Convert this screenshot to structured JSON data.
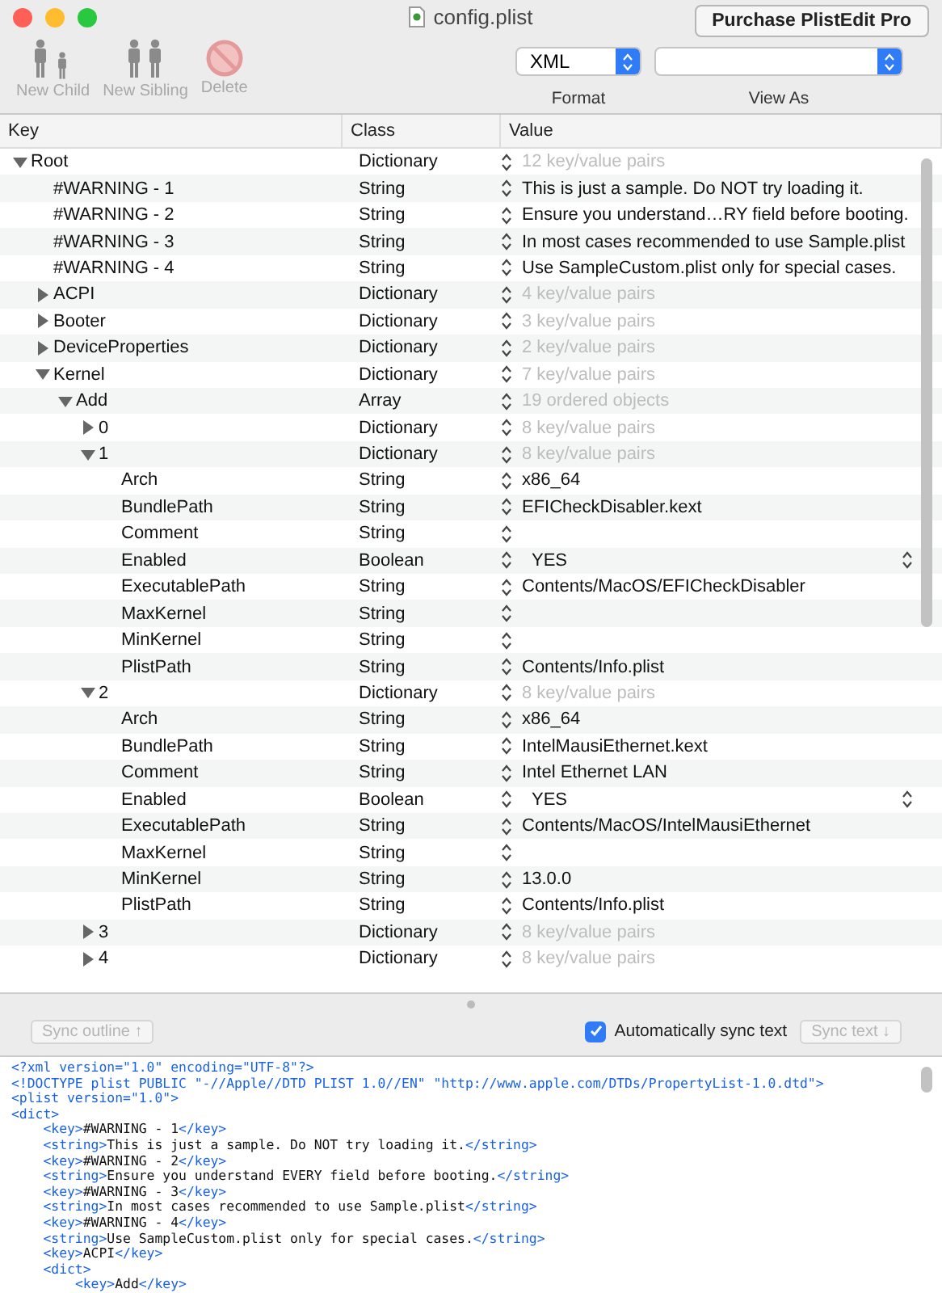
{
  "window": {
    "title": "config.plist"
  },
  "purchase_button": "Purchase PlistEdit Pro",
  "toolbar": [
    {
      "kind": "child",
      "label": "New Child",
      "disabled": true
    },
    {
      "kind": "sibling",
      "label": "New Sibling",
      "disabled": true
    },
    {
      "kind": "delete",
      "label": "Delete",
      "disabled": true
    }
  ],
  "format": {
    "value": "XML",
    "label": "Format"
  },
  "view_as": {
    "label": "View As"
  },
  "columns": [
    "Key",
    "Class",
    "Value"
  ],
  "tree": [
    {
      "key": "Root",
      "class": "Dictionary",
      "value": "12 key/value pairs",
      "kind": "summary",
      "expanded": true,
      "children": [
        {
          "key": "#WARNING - 1",
          "class": "String",
          "value": "This is just a sample. Do NOT try loading it.",
          "kind": "text"
        },
        {
          "key": "#WARNING - 2",
          "class": "String",
          "value": "Ensure you understand…RY field before booting.",
          "kind": "text"
        },
        {
          "key": "#WARNING - 3",
          "class": "String",
          "value": "In most cases recommended to use Sample.plist",
          "kind": "text"
        },
        {
          "key": "#WARNING - 4",
          "class": "String",
          "value": "Use SampleCustom.plist only for special cases.",
          "kind": "text"
        },
        {
          "key": "ACPI",
          "class": "Dictionary",
          "value": "4 key/value pairs",
          "kind": "summary",
          "expanded": false
        },
        {
          "key": "Booter",
          "class": "Dictionary",
          "value": "3 key/value pairs",
          "kind": "summary",
          "expanded": false
        },
        {
          "key": "DeviceProperties",
          "class": "Dictionary",
          "value": "2 key/value pairs",
          "kind": "summary",
          "expanded": false
        },
        {
          "key": "Kernel",
          "class": "Dictionary",
          "value": "7 key/value pairs",
          "kind": "summary",
          "expanded": true,
          "children": [
            {
              "key": "Add",
              "class": "Array",
              "value": "19 ordered objects",
              "kind": "summary",
              "expanded": true,
              "children": [
                {
                  "key": "0",
                  "class": "Dictionary",
                  "value": "8 key/value pairs",
                  "kind": "summary",
                  "expanded": false
                },
                {
                  "key": "1",
                  "class": "Dictionary",
                  "value": "8 key/value pairs",
                  "kind": "summary",
                  "expanded": true,
                  "children": [
                    {
                      "key": "Arch",
                      "class": "String",
                      "value": "x86_64",
                      "kind": "text"
                    },
                    {
                      "key": "BundlePath",
                      "class": "String",
                      "value": "EFICheckDisabler.kext",
                      "kind": "text"
                    },
                    {
                      "key": "Comment",
                      "class": "String",
                      "kind": "text"
                    },
                    {
                      "key": "Enabled",
                      "class": "Boolean",
                      "value": "YES",
                      "kind": "boolean"
                    },
                    {
                      "key": "ExecutablePath",
                      "class": "String",
                      "value": "Contents/MacOS/EFICheckDisabler",
                      "kind": "text"
                    },
                    {
                      "key": "MaxKernel",
                      "class": "String",
                      "kind": "text"
                    },
                    {
                      "key": "MinKernel",
                      "class": "String",
                      "kind": "text"
                    },
                    {
                      "key": "PlistPath",
                      "class": "String",
                      "value": "Contents/Info.plist",
                      "kind": "text"
                    }
                  ]
                },
                {
                  "key": "2",
                  "class": "Dictionary",
                  "value": "8 key/value pairs",
                  "kind": "summary",
                  "expanded": true,
                  "children": [
                    {
                      "key": "Arch",
                      "class": "String",
                      "value": "x86_64",
                      "kind": "text"
                    },
                    {
                      "key": "BundlePath",
                      "class": "String",
                      "value": "IntelMausiEthernet.kext",
                      "kind": "text"
                    },
                    {
                      "key": "Comment",
                      "class": "String",
                      "value": "Intel Ethernet LAN",
                      "kind": "text"
                    },
                    {
                      "key": "Enabled",
                      "class": "Boolean",
                      "value": "YES",
                      "kind": "boolean"
                    },
                    {
                      "key": "ExecutablePath",
                      "class": "String",
                      "value": "Contents/MacOS/IntelMausiEthernet",
                      "kind": "text"
                    },
                    {
                      "key": "MaxKernel",
                      "class": "String",
                      "kind": "text"
                    },
                    {
                      "key": "MinKernel",
                      "class": "String",
                      "value": "13.0.0",
                      "kind": "text"
                    },
                    {
                      "key": "PlistPath",
                      "class": "String",
                      "value": "Contents/Info.plist",
                      "kind": "text"
                    }
                  ]
                },
                {
                  "key": "3",
                  "class": "Dictionary",
                  "value": "8 key/value pairs",
                  "kind": "summary",
                  "expanded": false
                },
                {
                  "key": "4",
                  "class": "Dictionary",
                  "value": "8 key/value pairs",
                  "kind": "summary",
                  "expanded": false
                }
              ]
            }
          ]
        }
      ]
    }
  ],
  "sync_outline_button": {
    "label": "Sync outline ↑",
    "disabled": true
  },
  "auto_sync": {
    "label": "Automatically sync text",
    "checked": true
  },
  "sync_text_button": {
    "label": "Sync text ↓",
    "disabled": true
  },
  "xml_lines": [
    "<?xml version=\"1.0\" encoding=\"UTF-8\"?>",
    "<!DOCTYPE plist PUBLIC \"-//Apple//DTD PLIST 1.0//EN\" \"http://www.apple.com/DTDs/PropertyList-1.0.dtd\">",
    "<plist version=\"1.0\">",
    "<dict>",
    "    <key>#WARNING - 1</key>",
    "    <string>This is just a sample. Do NOT try loading it.</string>",
    "    <key>#WARNING - 2</key>",
    "    <string>Ensure you understand EVERY field before booting.</string>",
    "    <key>#WARNING - 3</key>",
    "    <string>In most cases recommended to use Sample.plist</string>",
    "    <key>#WARNING - 4</key>",
    "    <string>Use SampleCustom.plist only for special cases.</string>",
    "    <key>ACPI</key>",
    "    <dict>",
    "        <key>Add</key>"
  ]
}
